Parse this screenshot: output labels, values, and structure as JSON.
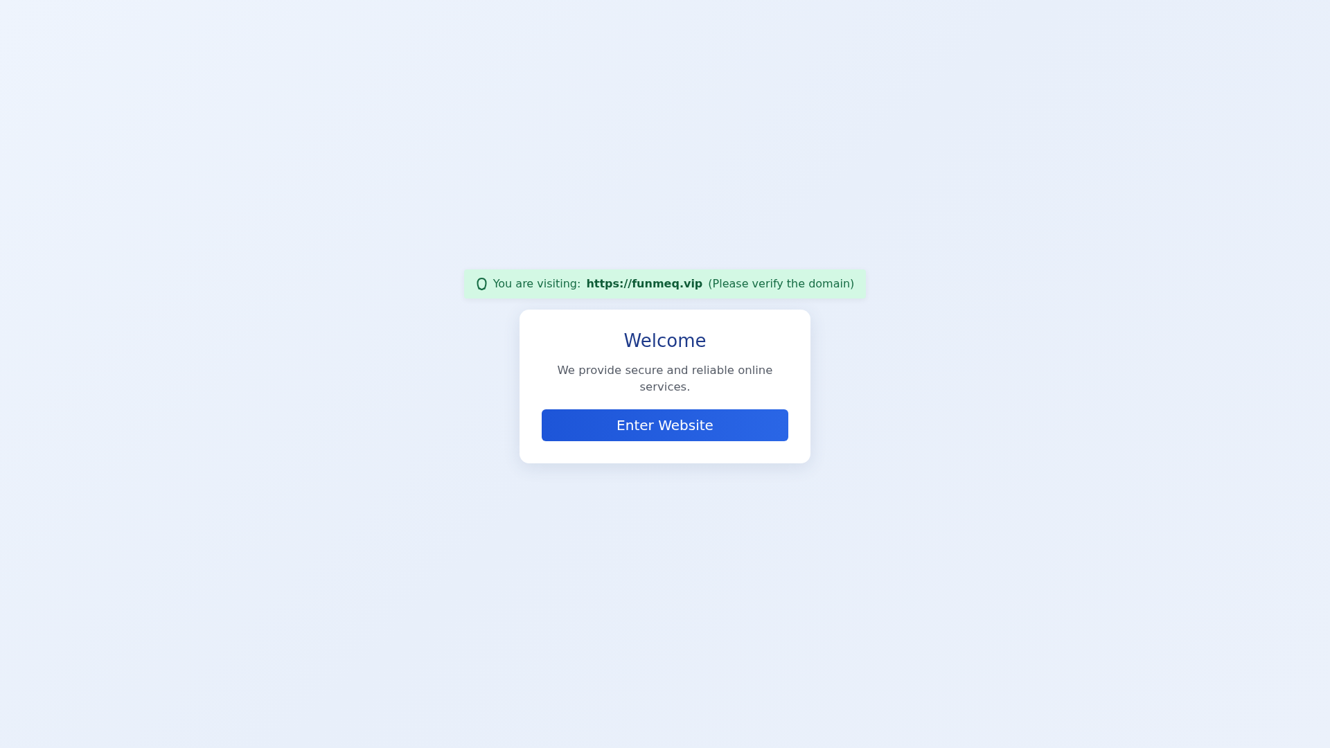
{
  "banner": {
    "label": "You are visiting:",
    "domain": "https://funmeq.vip",
    "note": "(Please verify the domain)"
  },
  "card": {
    "title": "Welcome",
    "text": "We provide secure and reliable online services.",
    "button": "Enter Website"
  }
}
